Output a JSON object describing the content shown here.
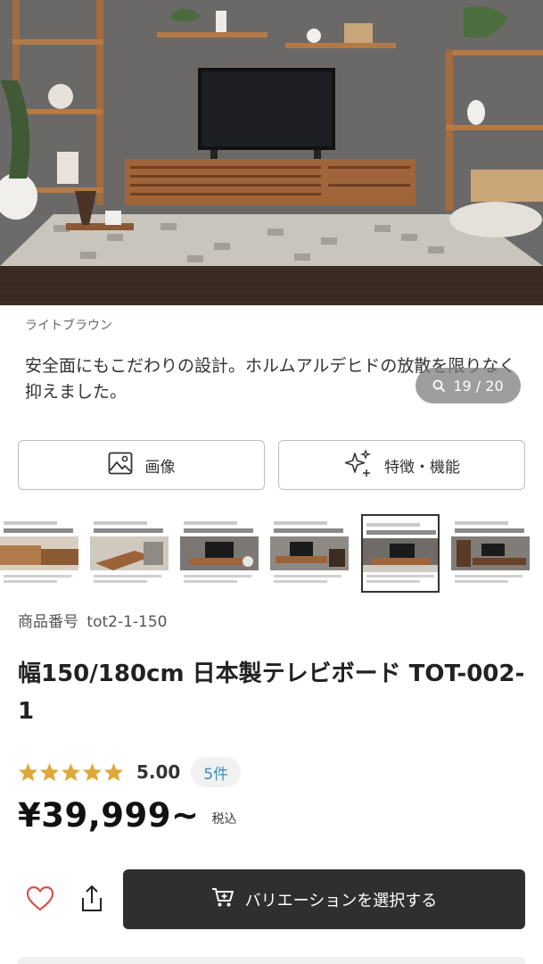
{
  "hero": {
    "alt_icon": "product-photo-tv-board-living-room",
    "colors": {
      "wall": "#6a6a6a",
      "floor": "#3a2b24",
      "wood": "#a0653a"
    }
  },
  "product": {
    "color_name": "ライトブラウン",
    "caption": "安全面にもこだわりの設計。ホルムアルデヒドの放散を限りなく抑えました。",
    "image_counter": "19 / 20",
    "sku_label": "商品番号",
    "sku": "tot2-1-150",
    "title": "幅150/180cm 日本製テレビボード TOT-002-1",
    "rating": "5.00",
    "review_count": "5件",
    "price": "¥39,999~",
    "tax_label": "税込"
  },
  "buttons": {
    "images_label": "画像",
    "features_label": "特徴・機能",
    "variation_label": "バリエーションを選択する"
  },
  "thumbnails": [
    {
      "caption": "スライドレールで開閉なめらか"
    },
    {
      "caption": "広々使える天板スペース"
    },
    {
      "caption": "大型テレビにも対応の耐荷重"
    },
    {
      "caption": "ロースタイルで部屋を広々"
    },
    {
      "caption": "國産ホルムの安全素材"
    },
    {
      "caption": "届いてすぐに使える完成品"
    }
  ],
  "colors": {
    "star": "#e0a83a",
    "link": "#3c8dbc",
    "cta_bg": "#2f2f2f",
    "heart": "#d9534f"
  },
  "icons": {
    "counter": "magnifier-icon",
    "images": "image-icon",
    "features": "sparkle-icon",
    "favorite": "heart-icon",
    "share": "share-icon",
    "cart": "cart-icon"
  }
}
